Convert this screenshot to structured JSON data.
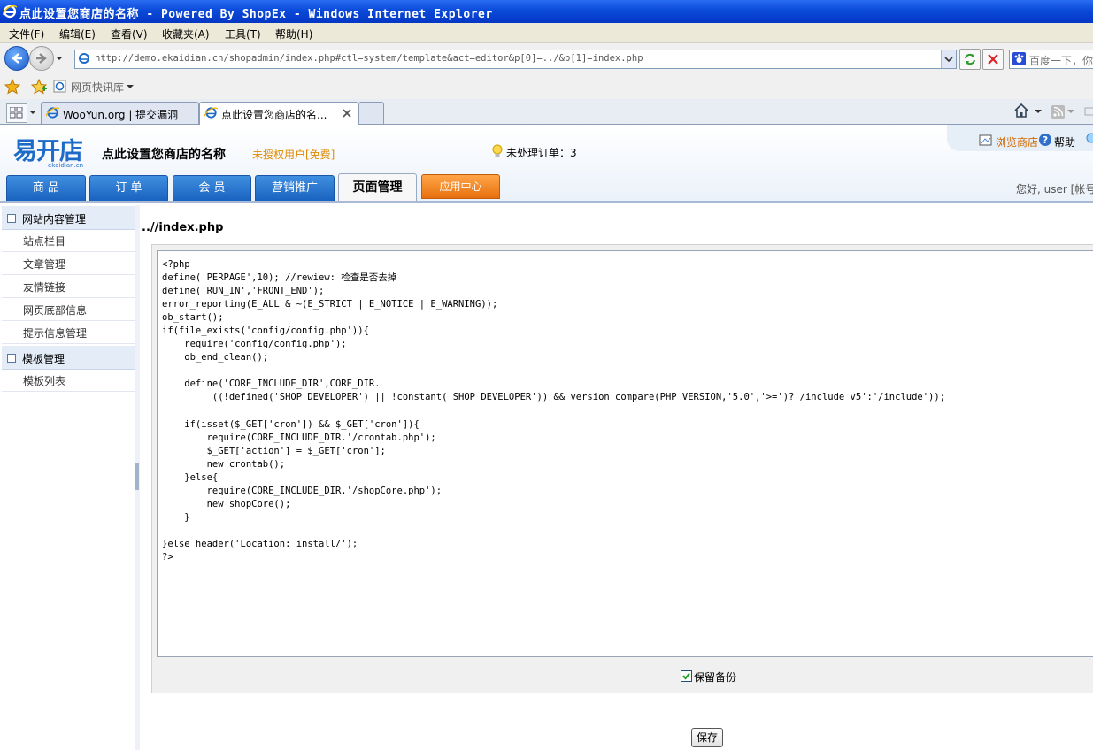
{
  "window": {
    "title": "点此设置您商店的名称 - Powered By ShopEx - Windows Internet Explorer"
  },
  "menu": [
    "文件(F)",
    "编辑(E)",
    "查看(V)",
    "收藏夹(A)",
    "工具(T)",
    "帮助(H)"
  ],
  "address": {
    "url": "http://demo.ekaidian.cn/shopadmin/index.php#ctl=system/template&act=editor&p[0]=../&p[1]=index.php"
  },
  "search": {
    "placeholder": "百度一下，你"
  },
  "favorites": {
    "label": "网页快讯库"
  },
  "tabs": [
    {
      "label": "WooYun.org | 提交漏洞"
    },
    {
      "label": "点此设置您商店的名..."
    }
  ],
  "app": {
    "logo": "易开店",
    "logo_sub": "ekaidian.cn",
    "shop_name": "点此设置您商店的名称",
    "license": "未授权用户[免费]",
    "orders": "未处理订单：3",
    "browse": "浏览商店",
    "help": "帮助",
    "greeting": "您好, user  [帐号"
  },
  "nav": [
    "商 品",
    "订 单",
    "会 员",
    "营销推广",
    "页面管理",
    "应用中心"
  ],
  "sidebar": {
    "group1": {
      "title": "网站内容管理",
      "items": [
        "站点栏目",
        "文章管理",
        "友情链接",
        "网页底部信息",
        "提示信息管理"
      ]
    },
    "group2": {
      "title": "模板管理",
      "items": [
        "模板列表"
      ]
    }
  },
  "editor": {
    "path": "..//index.php",
    "code": "<?php\ndefine('PERPAGE',10); //rewiew: 检查是否去掉\ndefine('RUN_IN','FRONT_END');\nerror_reporting(E_ALL & ~(E_STRICT | E_NOTICE | E_WARNING));\nob_start();\nif(file_exists('config/config.php')){\n    require('config/config.php');\n    ob_end_clean();\n\n    define('CORE_INCLUDE_DIR',CORE_DIR.\n         ((!defined('SHOP_DEVELOPER') || !constant('SHOP_DEVELOPER')) && version_compare(PHP_VERSION,'5.0','>=')?'/include_v5':'/include'));\n\n    if(isset($_GET['cron']) && $_GET['cron']){\n        require(CORE_INCLUDE_DIR.'/crontab.php');\n        $_GET['action'] = $_GET['cron'];\n        new crontab();\n    }else{\n        require(CORE_INCLUDE_DIR.'/shopCore.php');\n        new shopCore();\n    }\n\n}else header('Location: install/');\n?>",
    "backup_label": "保留备份",
    "backup_checked": true,
    "save_label": "保存"
  }
}
